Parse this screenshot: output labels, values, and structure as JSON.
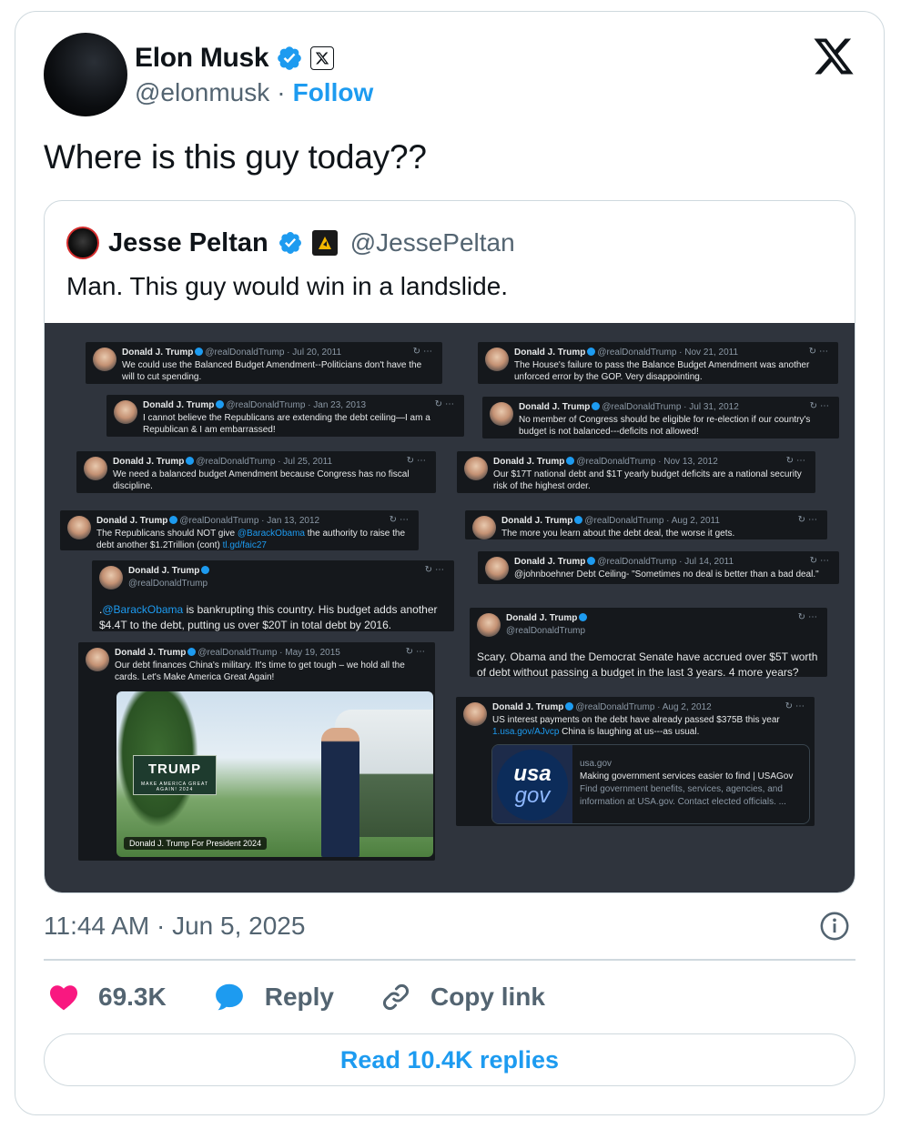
{
  "author": {
    "name": "Elon Musk",
    "handle": "@elonmusk",
    "separator": "·",
    "follow_label": "Follow"
  },
  "tweet_text": "Where is this guy today??",
  "quote": {
    "name": "Jesse Peltan",
    "handle": "@JessePeltan",
    "text": "Man. This guy would win in a landslide."
  },
  "collage": [
    {
      "name": "Donald J. Trump",
      "meta": "@realDonaldTrump · Jul 20, 2011",
      "text": "We could use the Balanced Budget Amendment--Politicians don't have the will to cut spending."
    },
    {
      "name": "Donald J. Trump",
      "meta": "@realDonaldTrump · Nov 21, 2011",
      "text": "The House's failure to pass the Balance Budget Amendment was another unforced error by the GOP. Very disappointing."
    },
    {
      "name": "Donald J. Trump",
      "meta": "@realDonaldTrump · Jan 23, 2013",
      "text": "I cannot believe the Republicans are extending the debt ceiling—I am a Republican & I am embarrassed!"
    },
    {
      "name": "Donald J. Trump",
      "meta": "@realDonaldTrump · Jul 31, 2012",
      "text": "No member of Congress should be eligible for re-election if our country's budget is not balanced---deficits not allowed!"
    },
    {
      "name": "Donald J. Trump",
      "meta": "@realDonaldTrump · Jul 25, 2011",
      "text": "We need a balanced budget Amendment because Congress has no fiscal discipline."
    },
    {
      "name": "Donald J. Trump",
      "meta": "@realDonaldTrump · Nov 13, 2012",
      "text": "Our $17T national debt and $1T yearly budget deficits are a national security risk of the highest order."
    },
    {
      "name": "Donald J. Trump",
      "meta": "@realDonaldTrump · Jan 13, 2012",
      "text_a": "The Republicans should NOT give ",
      "link_a": "@BarackObama",
      "text_b": " the authority to raise the debt another $1.2Trillion (cont) ",
      "link_b": "tl.gd/faic27"
    },
    {
      "name": "Donald J. Trump",
      "meta": "@realDonaldTrump · Aug 2, 2011",
      "text": "The more you learn about the debt deal, the worse it gets."
    },
    {
      "name": "Donald J. Trump",
      "meta": "@realDonaldTrump · Jul 14, 2011",
      "text": "@johnboehner Debt Ceiling- \"Sometimes no deal is better than a bad deal.\""
    },
    {
      "name": "Donald J. Trump",
      "meta": "@realDonaldTrump",
      "text_a": ".",
      "link_a": "@BarackObama",
      "text_b": " is bankrupting this country. His budget adds another $4.4T to the debt, putting us over $20T in total debt by 2016."
    },
    {
      "name": "Donald J. Trump",
      "meta": "@realDonaldTrump",
      "text": "Scary.  Obama and the Democrat Senate have accrued over $5T worth of debt without passing a budget in the last 3 years.  4 more years?"
    },
    {
      "name": "Donald J. Trump",
      "meta": "@realDonaldTrump · May 19, 2015",
      "text": "Our debt finances China's military. It's time to get tough – we hold all the cards. Let's Make America Great Again!"
    },
    {
      "name": "Donald J. Trump",
      "meta": "@realDonaldTrump · Aug 2, 2012",
      "text_a": "US interest payments on the debt have already passed $375B this year ",
      "link_a": "1.usa.gov/AJvcp",
      "text_b": "  China is laughing at us---as usual."
    }
  ],
  "photo": {
    "sign_text": "TRUMP",
    "sign_sub": "MAKE AMERICA GREAT AGAIN! 2024",
    "caption": "Donald J. Trump For President 2024"
  },
  "link_card": {
    "logo_top": "usa",
    "logo_bottom": "gov",
    "domain": "usa.gov",
    "title": "Making government services easier to find | USAGov",
    "desc": "Find government benefits, services, agencies, and information at USA.gov. Contact elected officials. ..."
  },
  "timestamp": "11:44 AM · Jun 5, 2025",
  "actions": {
    "likes": "69.3K",
    "reply_label": "Reply",
    "copy_label": "Copy link"
  },
  "read_replies_label": "Read 10.4K replies",
  "colors": {
    "accent": "#1d9bf0",
    "heart": "#f91880",
    "muted": "#536471",
    "border": "#cfd9de"
  }
}
